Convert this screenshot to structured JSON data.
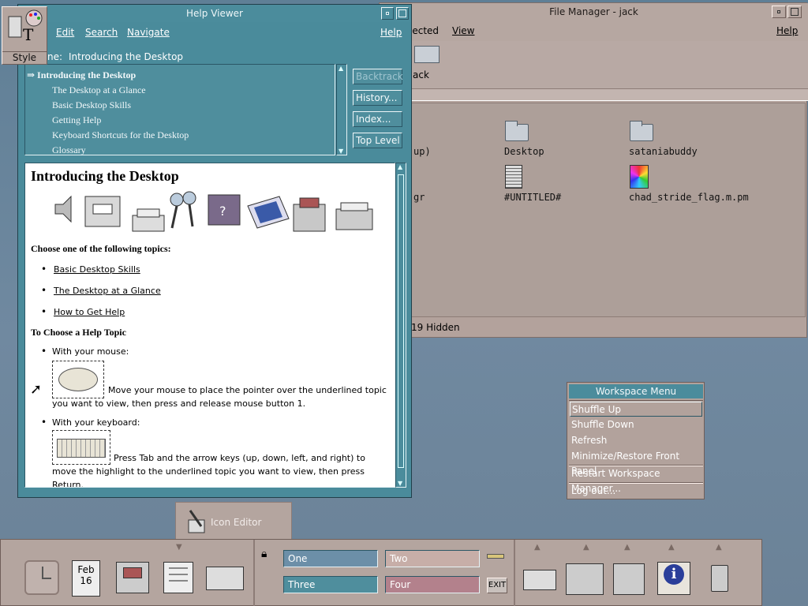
{
  "style_manager": {
    "label": "Style"
  },
  "file_manager": {
    "title": "File Manager - jack",
    "menus": [
      "lected",
      "View",
      "Help"
    ],
    "path_label": "ack",
    "items": [
      "up)",
      "Desktop",
      "sataniabuddy",
      "gr",
      "#UNTITLED#",
      "chad_stride_flag.m.pm"
    ],
    "status": "19 Hidden"
  },
  "help_viewer": {
    "title": "Help Viewer",
    "menus": [
      "Edit",
      "Search",
      "Navigate",
      "Help"
    ],
    "volume_label": "ne:",
    "volume_value": "Introducing the Desktop",
    "toc": [
      "⇒ Introducing the Desktop",
      "The Desktop at a Glance",
      "Basic Desktop Skills",
      "Getting Help",
      "Keyboard Shortcuts for the Desktop",
      "Glossary"
    ],
    "buttons": [
      "Backtrack",
      "History...",
      "Index...",
      "Top Level"
    ],
    "content": {
      "heading": "Introducing the Desktop",
      "choose": "Choose one of the following topics:",
      "links": [
        "Basic Desktop Skills",
        "The Desktop at a Glance",
        "How to Get Help"
      ],
      "subheading": "To Choose a Help Topic",
      "mouse_label": "With your mouse:",
      "mouse_text_1": "Move your mouse to place the pointer over the underlined topic",
      "mouse_text_2": "you want to view, then press and release mouse button 1.",
      "keyboard_label": "With your keyboard:",
      "keyboard_text_1": "Press Tab and the arrow keys (up, down, left, and right) to",
      "keyboard_text_2": "move the highlight to the underlined topic you want to view, then press",
      "keyboard_text_3": "Return."
    }
  },
  "icon_editor": {
    "label": "Icon Editor"
  },
  "workspace_menu": {
    "title": "Workspace Menu",
    "items": [
      "Shuffle Up",
      "Shuffle Down",
      "Refresh",
      "Minimize/Restore Front Panel",
      "Restart Workspace Manager...",
      "Log out..."
    ]
  },
  "front_panel": {
    "date_month": "Feb",
    "date_day": "16",
    "workspaces": [
      "One",
      "Two",
      "Three",
      "Four"
    ],
    "exit": "EXIT"
  }
}
